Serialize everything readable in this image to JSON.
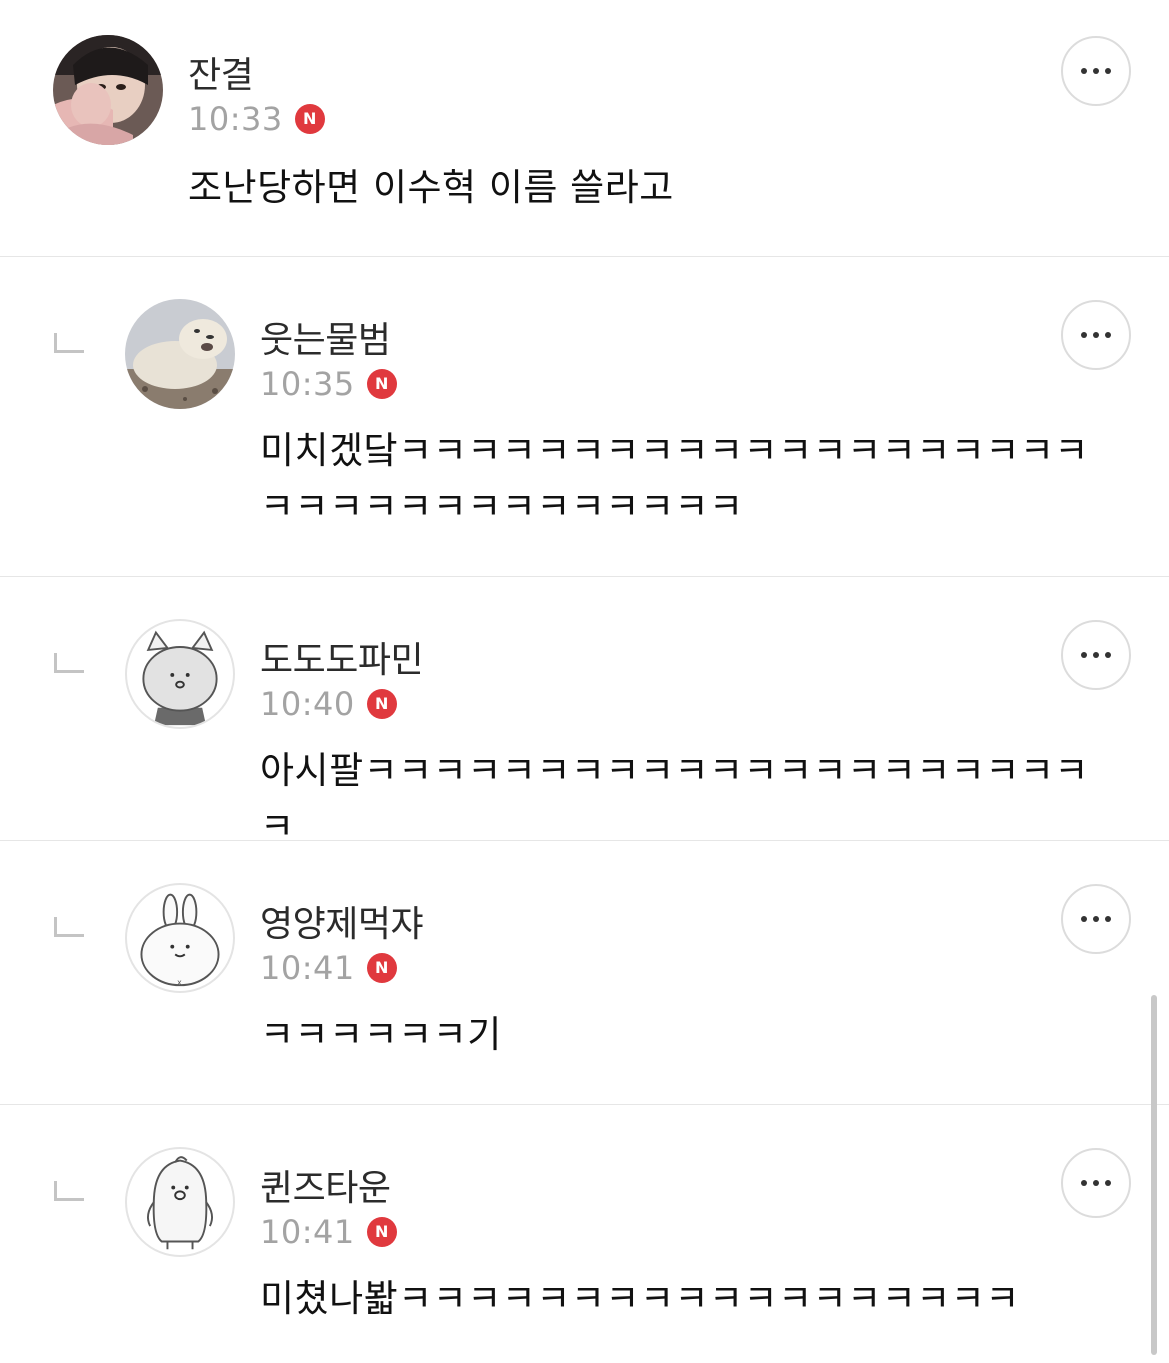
{
  "comments": [
    {
      "nickname": "잔결",
      "time": "10:33",
      "badge": "N",
      "text": "조난당하면 이수혁 이름 쓸라고",
      "avatar": "photo-avatar",
      "is_reply": false
    },
    {
      "nickname": "웃는물범",
      "time": "10:35",
      "badge": "N",
      "text": "미치겠닼ㅋㅋㅋㅋㅋㅋㅋㅋㅋㅋㅋㅋㅋㅋㅋㅋㅋㅋㅋㅋㅋㅋㅋㅋㅋㅋㅋㅋㅋㅋㅋㅋㅋㅋ",
      "avatar": "seal-avatar",
      "is_reply": true
    },
    {
      "nickname": "도도도파민",
      "time": "10:40",
      "badge": "N",
      "text": "아시팔ㅋㅋㅋㅋㅋㅋㅋㅋㅋㅋㅋㅋㅋㅋㅋㅋㅋㅋㅋㅋㅋㅋ",
      "avatar": "cat-avatar",
      "is_reply": true
    },
    {
      "nickname": "영양제먹쟈",
      "time": "10:41",
      "badge": "N",
      "text": "ㅋㅋㅋㅋㅋㅋ기",
      "avatar": "rabbit-avatar",
      "is_reply": true
    },
    {
      "nickname": "퀸즈타운",
      "time": "10:41",
      "badge": "N",
      "text": "미쳤나봛ㅋㅋㅋㅋㅋㅋㅋㅋㅋㅋㅋㅋㅋㅋㅋㅋㅋㅋ",
      "avatar": "penguin-avatar",
      "is_reply": true
    }
  ],
  "more_button_icon": "more-horizontal-icon",
  "reply_indicator_icon": "reply-corner-icon",
  "colors": {
    "badge": "#e0393e",
    "time": "#a3a3a3",
    "divider": "#e6e6e6"
  }
}
